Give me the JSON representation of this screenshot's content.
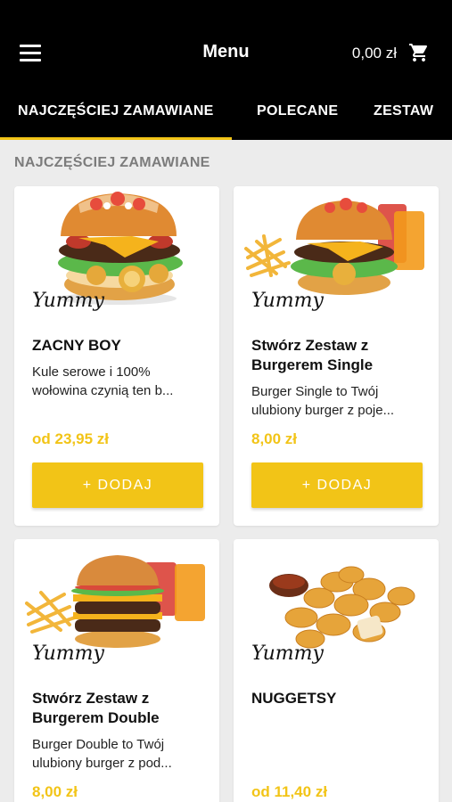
{
  "header": {
    "title": "Menu",
    "cart_total": "0,00 zł",
    "menu_icon": "hamburger-icon",
    "cart_icon": "shopping-cart-icon"
  },
  "tabs": [
    {
      "label": "NAJCZĘŚCIEJ ZAMAWIANE",
      "active": true
    },
    {
      "label": "POLECANE",
      "active": false
    },
    {
      "label": "ZESTAW",
      "active": false
    }
  ],
  "section": {
    "title": "NAJCZĘŚCIEJ ZAMAWIANE"
  },
  "products": [
    {
      "brand": "Yummy",
      "name": "ZACNY BOY",
      "desc_lines": [
        "Kule serowe i 100%",
        "wołowina czynią ten b..."
      ],
      "price": "od 23,95 zł",
      "button": "+ DODAJ",
      "image": "burger-image"
    },
    {
      "brand": "Yummy",
      "name_lines": [
        "Stwórz Zestaw z",
        "Burgerem Single"
      ],
      "desc_lines": [
        "Burger Single to Twój",
        "ulubiony burger z poje..."
      ],
      "price": "8,00 zł",
      "button": "+ DODAJ",
      "image": "burger-set-image"
    },
    {
      "brand": "Yummy",
      "name_lines": [
        "Stwórz Zestaw z",
        "Burgerem Double"
      ],
      "desc_lines": [
        "Burger Double to Twój",
        "ulubiony burger z pod..."
      ],
      "price": "8,00 zł",
      "image": "double-burger-set-image"
    },
    {
      "brand": "Yummy",
      "name": "NUGGETSY",
      "price": "od 11,40 zł",
      "image": "nuggets-image"
    }
  ],
  "colors": {
    "accent": "#f2c417",
    "header_bg": "#000000",
    "page_bg": "#ececec",
    "section_title": "#7c7c7c"
  }
}
